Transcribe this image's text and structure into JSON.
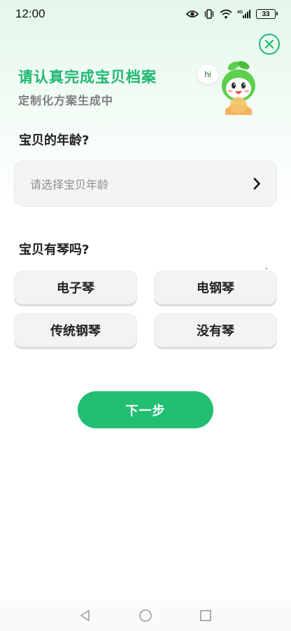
{
  "status_bar": {
    "time": "12:00",
    "battery": "33",
    "signal_label": "4G",
    "icons": [
      "eye-icon",
      "vibrate-icon",
      "wifi-icon",
      "signal-icon",
      "battery-icon"
    ]
  },
  "header": {
    "title": "请认真完成宝贝档案",
    "subtitle": "定制化方案生成中",
    "close_icon": "close-icon"
  },
  "mascot": {
    "bubble_text": "hi"
  },
  "age_section": {
    "label": "宝贝的年龄?",
    "placeholder": "请选择宝贝年龄",
    "chevron_icon": "chevron-right-icon"
  },
  "piano_section": {
    "label": "宝贝有琴吗?",
    "options": [
      "电子琴",
      "电钢琴",
      "传统钢琴",
      "没有琴"
    ]
  },
  "next_button": {
    "label": "下一步"
  },
  "nav_bar": {
    "icons": [
      "back-icon",
      "home-icon",
      "recents-icon"
    ]
  },
  "colors": {
    "accent": "#22bf72",
    "title_green": "#1fb872",
    "text_dark": "#222222",
    "text_muted": "#8f8f8f",
    "option_bg": "#f3f3f3"
  }
}
